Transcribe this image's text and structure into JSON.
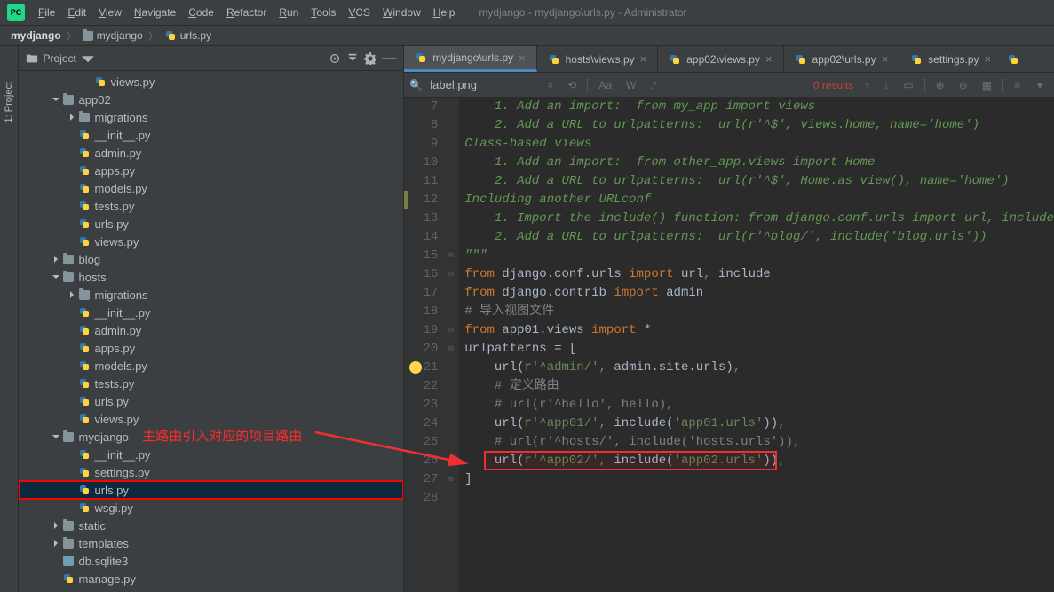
{
  "title": "mydjango - mydjango\\urls.py - Administrator",
  "menu": [
    "File",
    "Edit",
    "View",
    "Navigate",
    "Code",
    "Refactor",
    "Run",
    "Tools",
    "VCS",
    "Window",
    "Help"
  ],
  "breadcrumb": [
    {
      "label": "mydjango",
      "bold": true
    },
    {
      "label": "mydjango",
      "icon": "folder"
    },
    {
      "label": "urls.py",
      "icon": "py"
    }
  ],
  "sidetab": "1: Project",
  "project_pane_title": "Project",
  "tree": [
    {
      "d": 4,
      "k": "py",
      "n": "views.py"
    },
    {
      "d": 2,
      "k": "folder",
      "n": "app02",
      "arrow": "down"
    },
    {
      "d": 3,
      "k": "folder",
      "n": "migrations",
      "arrow": "right"
    },
    {
      "d": 3,
      "k": "py",
      "n": "__init__.py"
    },
    {
      "d": 3,
      "k": "py",
      "n": "admin.py"
    },
    {
      "d": 3,
      "k": "py",
      "n": "apps.py"
    },
    {
      "d": 3,
      "k": "py",
      "n": "models.py"
    },
    {
      "d": 3,
      "k": "py",
      "n": "tests.py"
    },
    {
      "d": 3,
      "k": "py",
      "n": "urls.py"
    },
    {
      "d": 3,
      "k": "py",
      "n": "views.py"
    },
    {
      "d": 2,
      "k": "folder",
      "n": "blog",
      "arrow": "right"
    },
    {
      "d": 2,
      "k": "folder",
      "n": "hosts",
      "arrow": "down"
    },
    {
      "d": 3,
      "k": "folder",
      "n": "migrations",
      "arrow": "right"
    },
    {
      "d": 3,
      "k": "py",
      "n": "__init__.py"
    },
    {
      "d": 3,
      "k": "py",
      "n": "admin.py"
    },
    {
      "d": 3,
      "k": "py",
      "n": "apps.py"
    },
    {
      "d": 3,
      "k": "py",
      "n": "models.py"
    },
    {
      "d": 3,
      "k": "py",
      "n": "tests.py"
    },
    {
      "d": 3,
      "k": "py",
      "n": "urls.py"
    },
    {
      "d": 3,
      "k": "py",
      "n": "views.py"
    },
    {
      "d": 2,
      "k": "folder",
      "n": "mydjango",
      "arrow": "down"
    },
    {
      "d": 3,
      "k": "py",
      "n": "__init__.py"
    },
    {
      "d": 3,
      "k": "py",
      "n": "settings.py"
    },
    {
      "d": 3,
      "k": "py",
      "n": "urls.py",
      "sel": true,
      "hl": true
    },
    {
      "d": 3,
      "k": "py",
      "n": "wsgi.py"
    },
    {
      "d": 2,
      "k": "folder",
      "n": "static",
      "arrow": "right"
    },
    {
      "d": 2,
      "k": "folder",
      "n": "templates",
      "arrow": "right"
    },
    {
      "d": 2,
      "k": "db",
      "n": "db.sqlite3"
    },
    {
      "d": 2,
      "k": "py",
      "n": "manage.py"
    }
  ],
  "tabs": [
    {
      "label": "mydjango\\urls.py",
      "active": true
    },
    {
      "label": "hosts\\views.py"
    },
    {
      "label": "app02\\views.py"
    },
    {
      "label": "app02\\urls.py"
    },
    {
      "label": "settings.py"
    }
  ],
  "search": {
    "query": "label.png",
    "results": "0 results"
  },
  "code": {
    "start": 7,
    "lines": [
      {
        "n": 7,
        "seg": [
          [
            "    1. Add an import:  from my_app import views",
            "c-com"
          ]
        ]
      },
      {
        "n": 8,
        "seg": [
          [
            "    2. Add a URL to urlpatterns:  url(r'^$', views.home, name='home')",
            "c-com"
          ]
        ]
      },
      {
        "n": 9,
        "seg": [
          [
            "Class-based views",
            "c-com"
          ]
        ]
      },
      {
        "n": 10,
        "seg": [
          [
            "    1. Add an import:  from other_app.views import Home",
            "c-com"
          ]
        ]
      },
      {
        "n": 11,
        "seg": [
          [
            "    2. Add a URL to urlpatterns:  url(r'^$', Home.as_view(), name='home')",
            "c-com"
          ]
        ]
      },
      {
        "n": 12,
        "seg": [
          [
            "Including another URLconf",
            "c-com"
          ]
        ],
        "vcs": true
      },
      {
        "n": 13,
        "seg": [
          [
            "    1. Import the include() function: from django.conf.urls import url, include",
            "c-com"
          ]
        ]
      },
      {
        "n": 14,
        "seg": [
          [
            "    2. Add a URL to urlpatterns:  url(r'^blog/', include('blog.urls'))",
            "c-com"
          ]
        ]
      },
      {
        "n": 15,
        "seg": [
          [
            "\"\"\"",
            "c-str"
          ]
        ],
        "fold": "up"
      },
      {
        "n": 16,
        "seg": [
          [
            "from ",
            "c-kw"
          ],
          [
            "django.conf.urls ",
            "c-id"
          ],
          [
            "import ",
            "c-kw"
          ],
          [
            "url",
            "c-id"
          ],
          [
            ", ",
            "c-gray"
          ],
          [
            "include",
            "c-id"
          ]
        ],
        "fold": "down"
      },
      {
        "n": 17,
        "seg": [
          [
            "from ",
            "c-kw"
          ],
          [
            "django.contrib ",
            "c-id"
          ],
          [
            "import ",
            "c-kw"
          ],
          [
            "admin",
            "c-id"
          ]
        ]
      },
      {
        "n": 18,
        "seg": [
          [
            "# 导入视图文件",
            "c-cmt"
          ]
        ]
      },
      {
        "n": 19,
        "seg": [
          [
            "from ",
            "c-kw"
          ],
          [
            "app01.views ",
            "c-id"
          ],
          [
            "import ",
            "c-kw"
          ],
          [
            "*",
            "c-id"
          ]
        ],
        "fold": "down"
      },
      {
        "n": 20,
        "seg": [
          [
            "urlpatterns = [",
            "c-id"
          ]
        ],
        "fold": "down"
      },
      {
        "n": 21,
        "seg": [
          [
            "    url(",
            "c-func"
          ],
          [
            "r'^admin/'",
            "c-str2"
          ],
          [
            ", ",
            "c-gray"
          ],
          [
            "admin.site.urls)",
            "c-id"
          ],
          [
            ",",
            "c-gray"
          ]
        ],
        "hint": true,
        "cursor": true
      },
      {
        "n": 22,
        "seg": [
          [
            "    # 定义路由",
            "c-cmt"
          ]
        ]
      },
      {
        "n": 23,
        "seg": [
          [
            "    # url(r'^hello', hello),",
            "c-cmt"
          ]
        ]
      },
      {
        "n": 24,
        "seg": [
          [
            "    url(",
            "c-func"
          ],
          [
            "r'^app01/'",
            "c-str2"
          ],
          [
            ", ",
            "c-gray"
          ],
          [
            "include(",
            "c-func"
          ],
          [
            "'app01.urls'",
            "c-str2"
          ],
          [
            "))",
            "c-id"
          ],
          [
            ",",
            "c-gray"
          ]
        ]
      },
      {
        "n": 25,
        "seg": [
          [
            "    # url(r'^hosts/', include('hosts.urls')),",
            "c-cmt"
          ]
        ]
      },
      {
        "n": 26,
        "seg": [
          [
            "    url(",
            "c-func"
          ],
          [
            "r'^app02/'",
            "c-str2"
          ],
          [
            ", ",
            "c-gray"
          ],
          [
            "include(",
            "c-func"
          ],
          [
            "'app02.urls'",
            "c-str2"
          ],
          [
            "))",
            "c-id"
          ],
          [
            ",",
            "c-gray"
          ]
        ],
        "boxed": true
      },
      {
        "n": 27,
        "seg": [
          [
            "]",
            "c-id"
          ]
        ],
        "fold": "up"
      },
      {
        "n": 28,
        "seg": [
          [
            "",
            ""
          ]
        ]
      }
    ]
  },
  "annotation_text": "主路由引入对应的项目路由"
}
